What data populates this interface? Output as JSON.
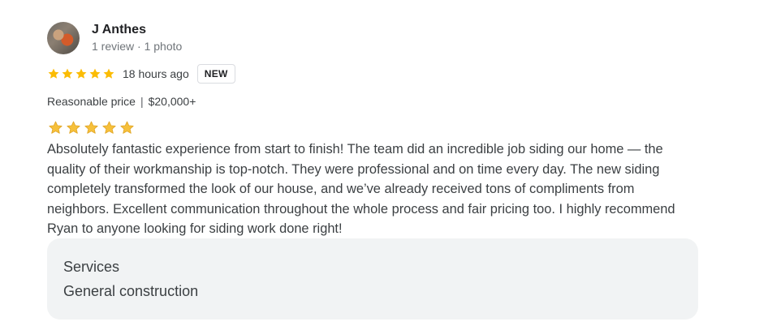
{
  "reviewer": {
    "name": "J Anthes",
    "meta": "1 review · 1 photo"
  },
  "rating": {
    "stars": 5,
    "time": "18 hours ago",
    "badge": "NEW",
    "star_color": "#fbbc04"
  },
  "price": {
    "label": "Reasonable price",
    "separator": "|",
    "value": "$20,000+"
  },
  "big_stars": {
    "count": 5,
    "color": "#f6c03b"
  },
  "review": {
    "text": "Absolutely fantastic experience from start to finish! The team did an incredible job siding our home — the quality of their workmanship is top-notch. They were professional and on time every day. The new siding completely transformed the look of our house, and we’ve already received tons of compliments from neighbors. Excellent communication throughout the whole process and fair pricing too. I highly recommend Ryan to anyone looking for siding work done right!"
  },
  "services": {
    "title": "Services",
    "value": "General construction"
  }
}
